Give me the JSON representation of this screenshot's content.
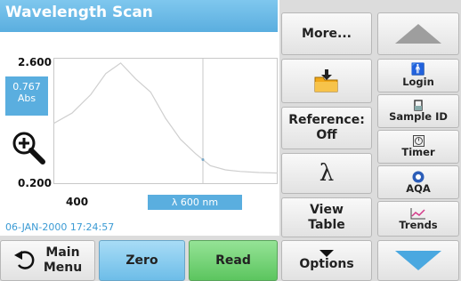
{
  "title": "Wavelength Scan",
  "chart_data": {
    "type": "line",
    "x": [
      400,
      425,
      450,
      470,
      490,
      510,
      530,
      550,
      570,
      590,
      610,
      630,
      650,
      675,
      700
    ],
    "y": [
      1.35,
      1.55,
      1.9,
      2.3,
      2.5,
      2.2,
      1.95,
      1.45,
      1.05,
      0.78,
      0.55,
      0.47,
      0.44,
      0.42,
      0.41
    ],
    "ylim": [
      0.2,
      2.6
    ],
    "xlim": [
      400,
      700
    ],
    "cursor_x": 600
  },
  "plot": {
    "ymax": "2.600",
    "ymin": "0.200",
    "xmin": "400",
    "readout_value": "0.767",
    "readout_unit": "Abs",
    "cursor": "λ 600 nm",
    "datetime": "06-JAN-2000  17:24:57"
  },
  "buttons": {
    "more": "More...",
    "reference_line1": "Reference:",
    "reference_line2": "Off",
    "lambda": "λ",
    "view_table_line1": "View",
    "view_table_line2": "Table",
    "options": "Options",
    "main_menu_line1": "Main",
    "main_menu_line2": "Menu",
    "zero": "Zero",
    "read": "Read"
  },
  "side": {
    "login": "Login",
    "sample_id": "Sample ID",
    "timer": "Timer",
    "aqa": "AQA",
    "trends": "Trends"
  },
  "icons": {
    "folder": "folder-download-icon",
    "zoom": "zoom-in-icon",
    "up": "scroll-up-icon",
    "down": "scroll-down-icon"
  },
  "colors": {
    "accent_blue": "#5aaedf",
    "read_green": "#5cc55f",
    "zero_blue": "#6dbde8",
    "folder_orange": "#f1a81a"
  }
}
